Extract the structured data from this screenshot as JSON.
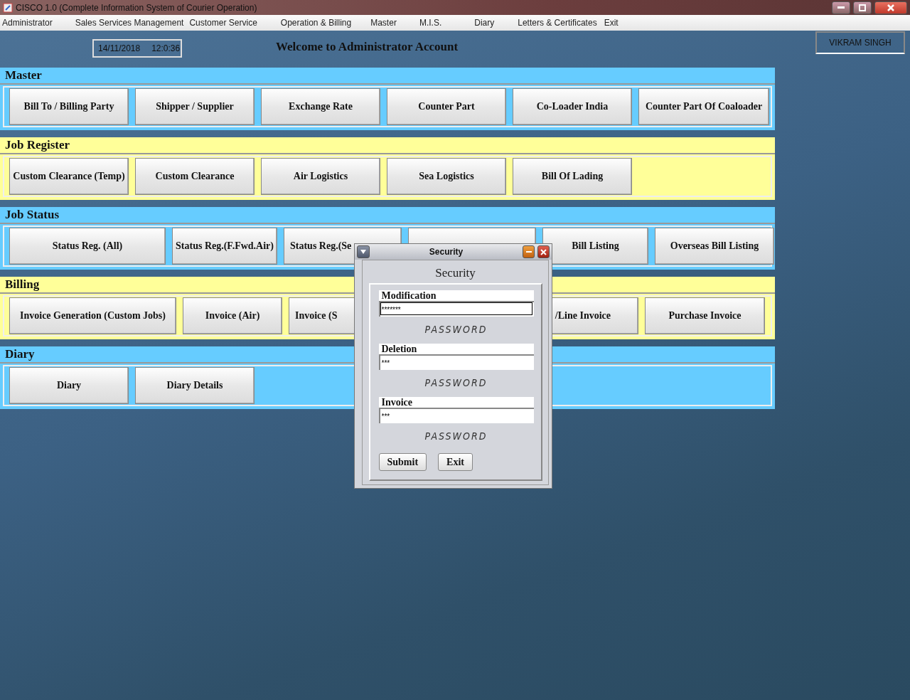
{
  "window": {
    "title": "CISCO 1.0 (Complete Information System of Courier Operation)"
  },
  "menu": [
    "Administrator",
    "Sales Services Management",
    "Customer Service",
    "Operation & Billing",
    "Master",
    "M.I.S.",
    "Diary",
    "Letters & Certificates",
    "Exit"
  ],
  "header": {
    "date": "14/11/2018",
    "time": "12:0:36",
    "welcome": "Welcome to Administrator Account",
    "user": "VIKRAM SINGH"
  },
  "sections": [
    {
      "title": "Master",
      "color": "#66ccff",
      "buttons": [
        {
          "kind": "full",
          "label": "Bill To / Billing Party"
        },
        {
          "kind": "full",
          "label": "Shipper / Supplier"
        },
        {
          "kind": "full",
          "label": "Exchange Rate"
        },
        {
          "kind": "full",
          "label": "Counter Part"
        },
        {
          "kind": "full",
          "label": "Co-Loader India"
        },
        {
          "kind": "full",
          "label": "Counter Part Of Coaloader"
        }
      ]
    },
    {
      "title": "Job Register",
      "color": "#ffff99",
      "buttons": [
        {
          "kind": "full",
          "label": "Custom Clearance (Temp)"
        },
        {
          "kind": "full",
          "label": "Custom Clearance"
        },
        {
          "kind": "full",
          "label": "Air Logistics"
        },
        {
          "kind": "full",
          "label": "Sea Logistics"
        },
        {
          "kind": "full",
          "label": "Bill Of Lading"
        }
      ]
    },
    {
      "title": "Job Status",
      "color": "#66ccff",
      "buttons": [
        {
          "kind": "full",
          "label": "Status Reg. (All)"
        },
        {
          "kind": "full",
          "label": "Status Reg.(F.Fwd.Air)"
        },
        {
          "kind": "cutend",
          "label": "Status Reg.(Se"
        },
        {
          "kind": "covered"
        },
        {
          "kind": "full",
          "label": "Bill Listing"
        },
        {
          "kind": "full",
          "label": "Overseas Bill Listing"
        }
      ]
    },
    {
      "title": "Billing",
      "color": "#ffff99",
      "buttons": [
        {
          "kind": "full",
          "label": "Invoice Generation (Custom Jobs)"
        },
        {
          "kind": "full",
          "label": "Invoice (Air)"
        },
        {
          "kind": "cutend",
          "label": "Invoice (S"
        },
        {
          "kind": "cutstart",
          "label": "/Line Invoice"
        },
        {
          "kind": "full",
          "label": "Purchase Invoice"
        }
      ]
    },
    {
      "title": "Diary",
      "color": "#66ccff",
      "buttons": [
        {
          "kind": "full",
          "label": "Diary"
        },
        {
          "kind": "full",
          "label": "Diary Details"
        }
      ]
    }
  ],
  "dialog": {
    "title": "Security",
    "heading": "Security",
    "fields": [
      {
        "label": "Modification",
        "value": "*******",
        "focused": true,
        "caption": "PASSWORD"
      },
      {
        "label": "Deletion",
        "value": "***",
        "focused": false,
        "caption": "PASSWORD"
      },
      {
        "label": "Invoice",
        "value": "***",
        "focused": false,
        "caption": "PASSWORD"
      }
    ],
    "buttons": [
      "Submit",
      "Exit"
    ]
  }
}
